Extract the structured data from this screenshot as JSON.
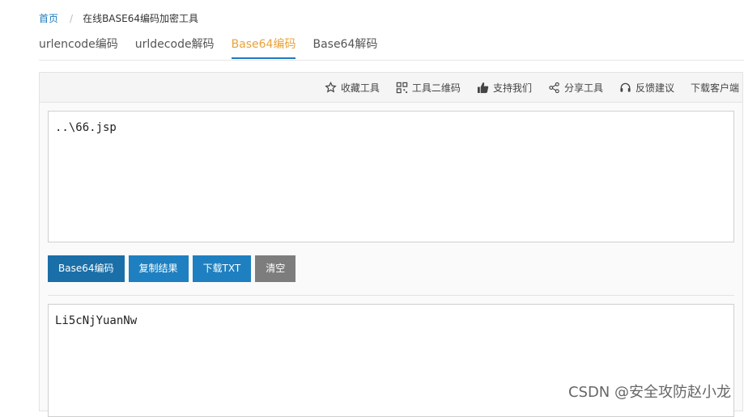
{
  "breadcrumb": {
    "home": "首页",
    "separator": "/",
    "current": "在线BASE64编码加密工具"
  },
  "tabs": [
    {
      "label": "urlencode编码",
      "active": false
    },
    {
      "label": "urldecode解码",
      "active": false
    },
    {
      "label": "Base64编码",
      "active": true
    },
    {
      "label": "Base64解码",
      "active": false
    }
  ],
  "toolbar": {
    "favorite": "收藏工具",
    "qrcode": "工具二维码",
    "support": "支持我们",
    "share": "分享工具",
    "feedback": "反馈建议",
    "download_client": "下载客户端"
  },
  "input": {
    "value": "..\\66.jsp"
  },
  "buttons": {
    "encode": "Base64编码",
    "copy": "复制结果",
    "download_txt": "下载TXT",
    "clear": "清空"
  },
  "output": {
    "value": "Li5cNjYuanNw"
  },
  "watermark": "CSDN @安全攻防赵小龙",
  "colors": {
    "accent_blue": "#1e7bbd",
    "active_tab_text": "#e8a33a",
    "button_primary": "#1a6fa8",
    "button_gray": "#7d7d7d"
  }
}
